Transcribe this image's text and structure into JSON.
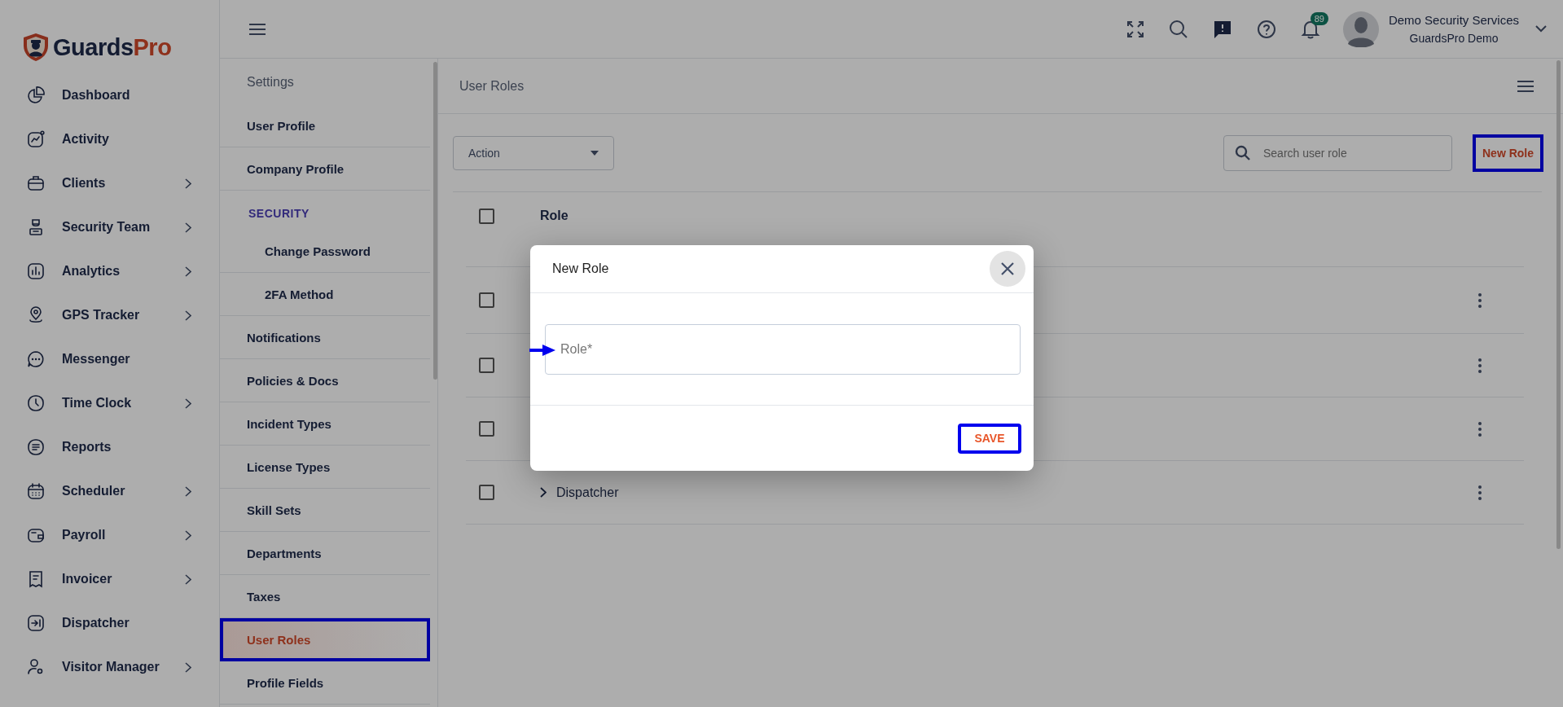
{
  "brand": {
    "name_part_1": "Guards",
    "name_part_2": "Pro"
  },
  "nav": [
    {
      "label": "Dashboard",
      "expandable": false
    },
    {
      "label": "Activity",
      "expandable": false
    },
    {
      "label": "Clients",
      "expandable": true
    },
    {
      "label": "Security Team",
      "expandable": true
    },
    {
      "label": "Analytics",
      "expandable": true
    },
    {
      "label": "GPS Tracker",
      "expandable": true
    },
    {
      "label": "Messenger",
      "expandable": false
    },
    {
      "label": "Time Clock",
      "expandable": true
    },
    {
      "label": "Reports",
      "expandable": false
    },
    {
      "label": "Scheduler",
      "expandable": true
    },
    {
      "label": "Payroll",
      "expandable": true
    },
    {
      "label": "Invoicer",
      "expandable": true
    },
    {
      "label": "Dispatcher",
      "expandable": false
    },
    {
      "label": "Visitor Manager",
      "expandable": true
    }
  ],
  "topbar": {
    "notification_count": "89",
    "user_name": "Demo Security Services",
    "company": "GuardsPro Demo"
  },
  "settings": {
    "title": "Settings",
    "items": [
      {
        "kind": "item",
        "label": "User Profile",
        "selected": false,
        "highlighted": false
      },
      {
        "kind": "item",
        "label": "Company Profile",
        "selected": false,
        "highlighted": false
      },
      {
        "kind": "section",
        "label": "SECURITY"
      },
      {
        "kind": "subitem",
        "label": "Change Password",
        "selected": false,
        "highlighted": false
      },
      {
        "kind": "subitem",
        "label": "2FA Method",
        "selected": false,
        "highlighted": false
      },
      {
        "kind": "item",
        "label": "Notifications",
        "selected": false,
        "highlighted": false
      },
      {
        "kind": "item",
        "label": "Policies & Docs",
        "selected": false,
        "highlighted": false
      },
      {
        "kind": "item",
        "label": "Incident Types",
        "selected": false,
        "highlighted": false
      },
      {
        "kind": "item",
        "label": "License Types",
        "selected": false,
        "highlighted": false
      },
      {
        "kind": "item",
        "label": "Skill Sets",
        "selected": false,
        "highlighted": false
      },
      {
        "kind": "item",
        "label": "Departments",
        "selected": false,
        "highlighted": false
      },
      {
        "kind": "item",
        "label": "Taxes",
        "selected": false,
        "highlighted": false
      },
      {
        "kind": "item",
        "label": "User Roles",
        "selected": true,
        "highlighted": true
      },
      {
        "kind": "item",
        "label": "Profile Fields",
        "selected": false,
        "highlighted": false
      }
    ]
  },
  "page": {
    "title": "User Roles",
    "action": "Action",
    "search": {
      "placeholder": "Search user role"
    },
    "new_role_button": {
      "label": "New Role",
      "highlighted": true
    }
  },
  "table": {
    "header_checked": false,
    "columns": [
      "Role"
    ],
    "rows": [
      {
        "checked": false
      },
      {
        "checked": false
      },
      {
        "checked": false
      },
      {
        "checked": false,
        "role": "Dispatcher",
        "expanded": false
      }
    ]
  },
  "modal": {
    "title": "New Role",
    "field": {
      "placeholder": "Role*",
      "pointer": true
    },
    "save_button": {
      "label": "SAVE",
      "highlighted": true
    }
  }
}
